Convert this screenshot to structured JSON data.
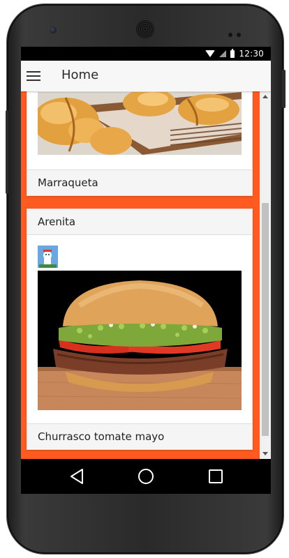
{
  "status_bar": {
    "time": "12:30",
    "icons": [
      "wifi-icon",
      "signal-icon",
      "battery-icon"
    ]
  },
  "app_bar": {
    "title": "Home",
    "menu_icon": "hamburger-menu-icon"
  },
  "cards": [
    {
      "image": "marraqueta-bread-photo",
      "footer": "Marraqueta"
    },
    {
      "header": "Arenita",
      "thumbnail": "avatar-thumbnail",
      "image": "churrasco-burger-photo",
      "footer": "Churrasco tomate mayo"
    }
  ],
  "navigation": {
    "buttons": [
      "back-icon",
      "home-icon",
      "recents-icon"
    ]
  },
  "colors": {
    "accent": "#ff5a1f",
    "app_bar_bg": "#f7f7f7",
    "card_header_bg": "#f5f5f5",
    "status_bar_bg": "#000000"
  }
}
